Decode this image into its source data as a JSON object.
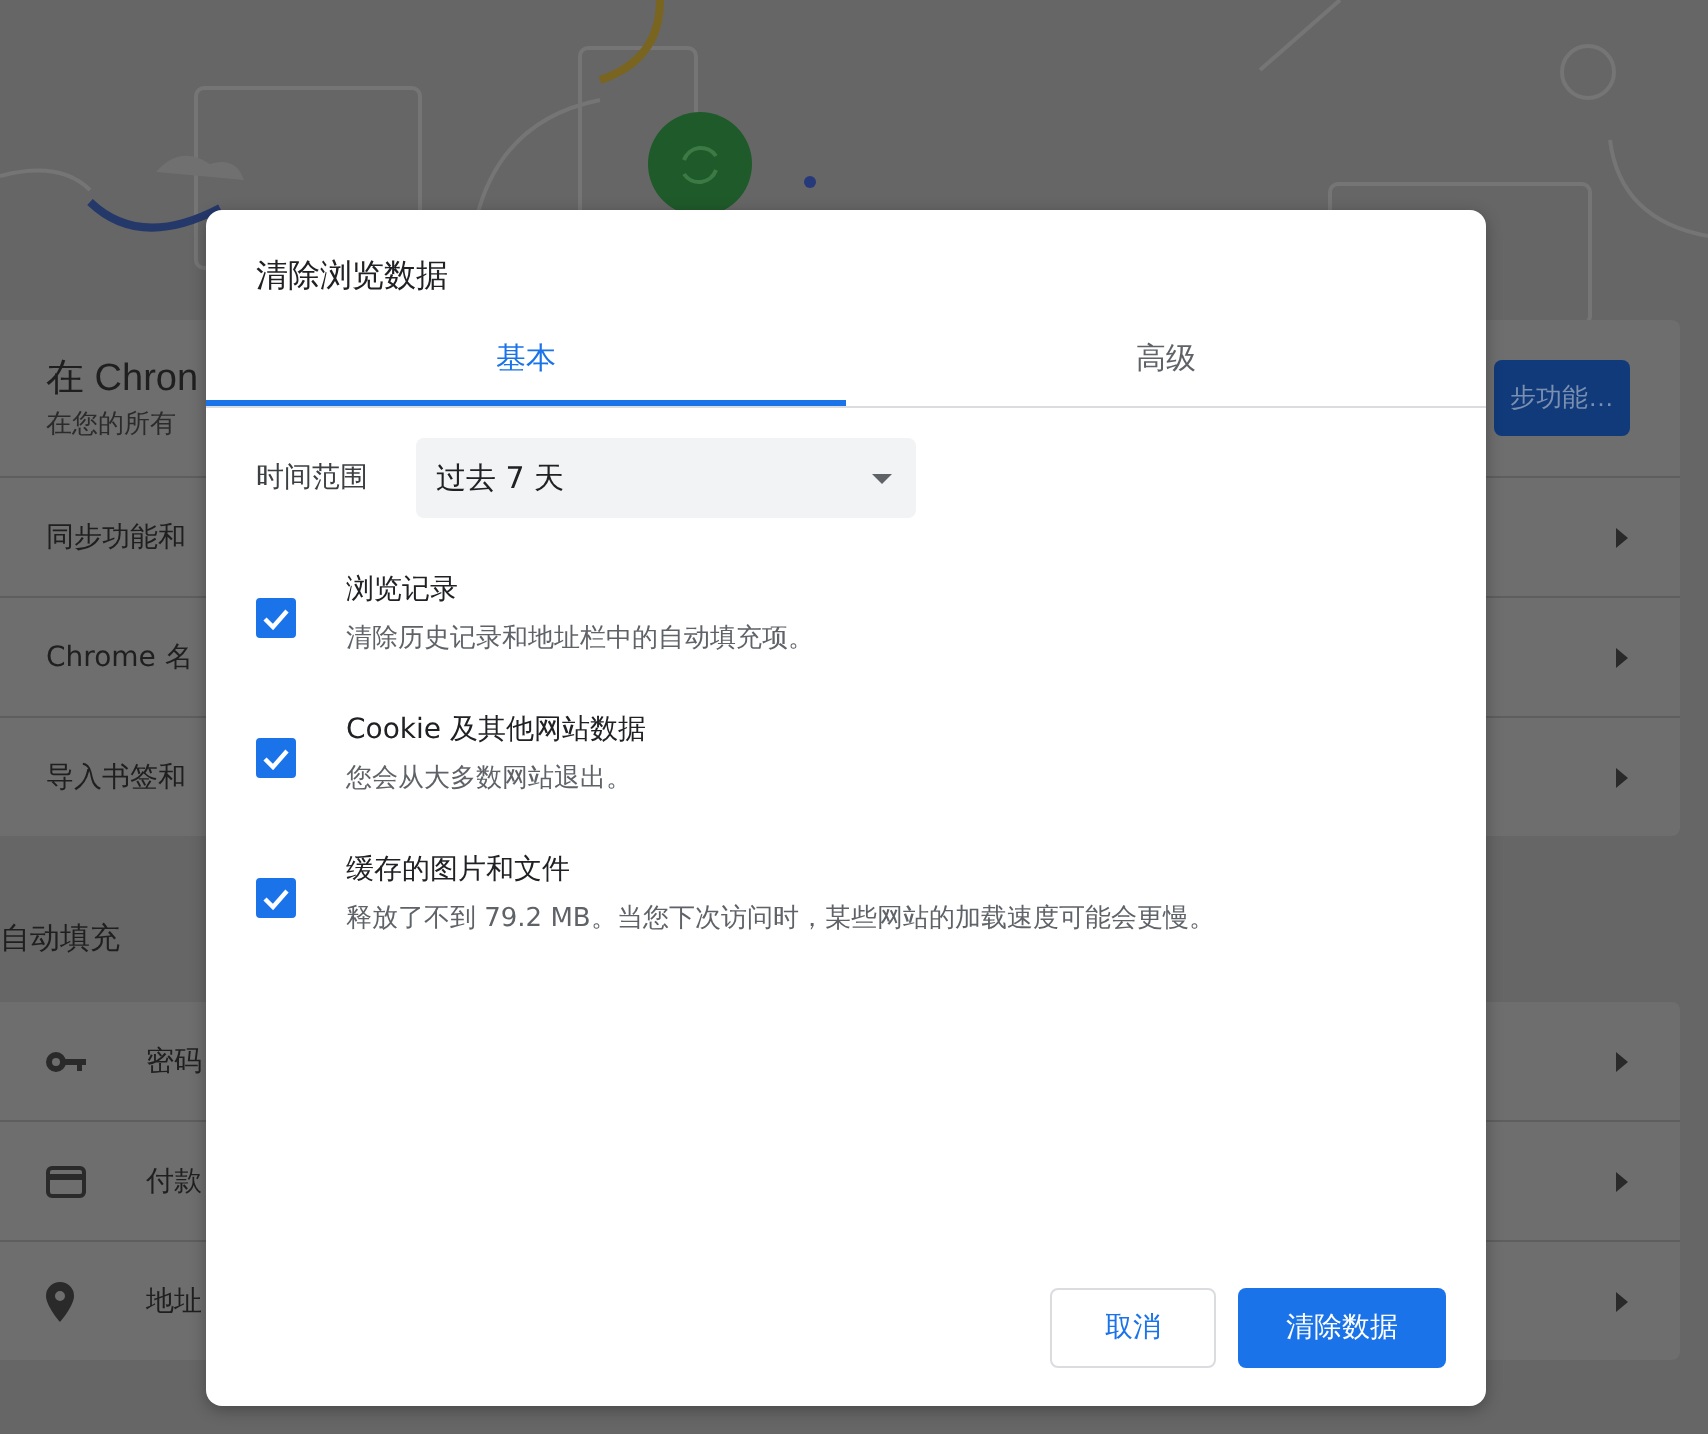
{
  "background_page": {
    "banner_heading": "在 Chron",
    "banner_subtitle": "在您的所有",
    "sync_button": "步功能…",
    "rows": [
      {
        "label": "同步功能和"
      },
      {
        "label": "Chrome 名"
      },
      {
        "label": "导入书签和"
      }
    ],
    "section_title": "自动填充",
    "autofill_rows": [
      {
        "kind": "key",
        "label": "密码"
      },
      {
        "kind": "card",
        "label": "付款"
      },
      {
        "kind": "pin",
        "label": "地址"
      }
    ]
  },
  "dialog": {
    "title": "清除浏览数据",
    "tabs": [
      {
        "label": "基本",
        "selected": true
      },
      {
        "label": "高级",
        "selected": false
      }
    ],
    "time_range": {
      "label": "时间范围",
      "value": "过去 7 天"
    },
    "options": [
      {
        "title": "浏览记录",
        "description": "清除历史记录和地址栏中的自动填充项。",
        "checked": true
      },
      {
        "title": "Cookie 及其他网站数据",
        "description": "您会从大多数网站退出。",
        "checked": true
      },
      {
        "title": "缓存的图片和文件",
        "description": "释放了不到 79.2 MB。当您下次访问时，某些网站的加载速度可能会更慢。",
        "checked": true
      }
    ],
    "buttons": [
      {
        "kind": "secondary",
        "label": "取消"
      },
      {
        "kind": "primary",
        "label": "清除数据"
      }
    ]
  }
}
